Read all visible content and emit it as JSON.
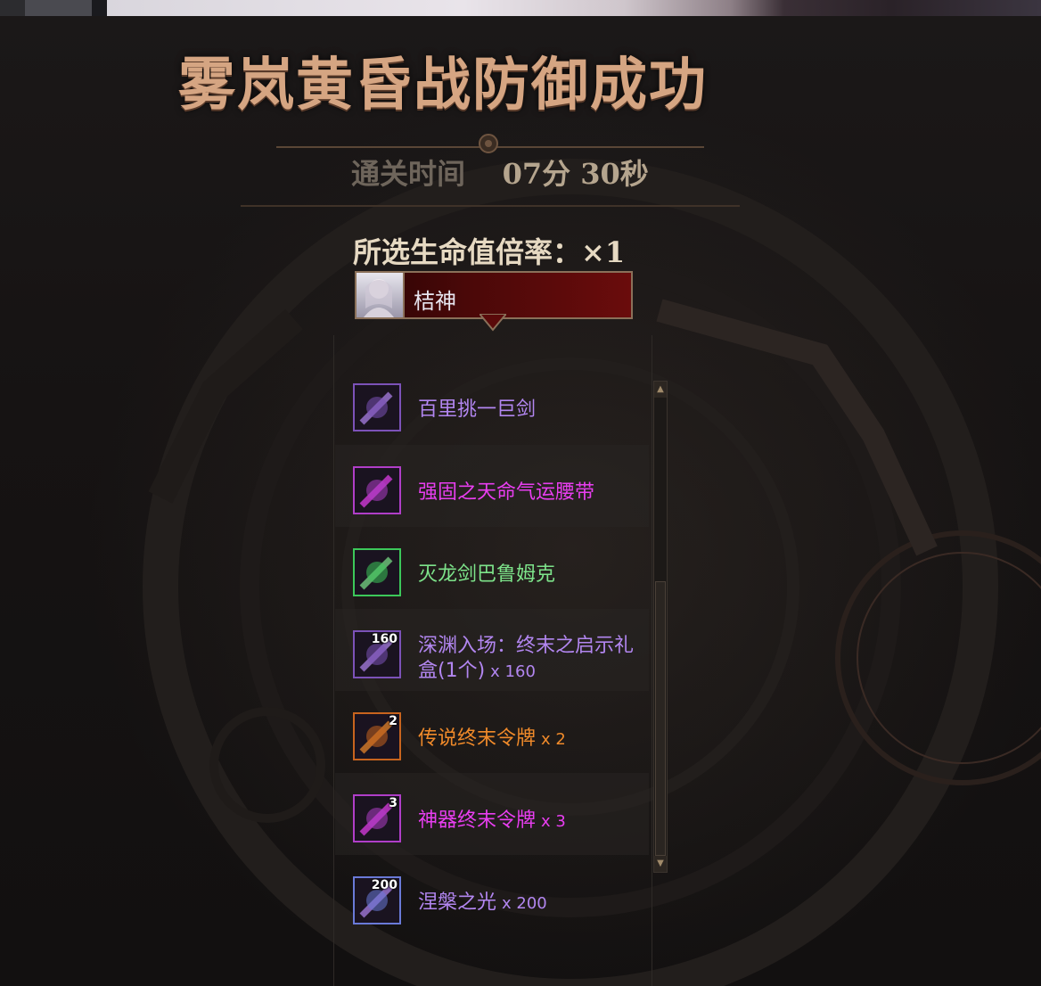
{
  "result": {
    "title": "雾岚黄昏战防御成功",
    "clear_time_label": "通关时间",
    "clear_time_value": "07分 30秒",
    "life_multiplier_label": "所选生命值倍率：×1"
  },
  "character": {
    "name": "桔神"
  },
  "rewards": [
    {
      "name": "百里挑一巨剑",
      "count": "",
      "icon_qty": "",
      "color": "#b286f0",
      "icon": "greatsword-icon",
      "frame": "#7c52b8"
    },
    {
      "name": "强固之天命气运腰带",
      "count": "",
      "icon_qty": "",
      "color": "#e83ef0",
      "icon": "belt-icon",
      "frame": "#b03ec8"
    },
    {
      "name": "灭龙剑巴鲁姆克",
      "count": "",
      "icon_qty": "",
      "color": "#7de38a",
      "icon": "dragon-sword-icon",
      "frame": "#3cc85a"
    },
    {
      "name": "深渊入场：终末之启示礼盒(1个)",
      "count": "x 160",
      "icon_qty": "160",
      "color": "#b286f0",
      "icon": "gift-box-icon",
      "frame": "#7c52b8"
    },
    {
      "name": "传说终末令牌",
      "count": "x 2",
      "icon_qty": "2",
      "color": "#f08a2a",
      "icon": "legendary-token-icon",
      "frame": "#c8641e"
    },
    {
      "name": "神器终末令牌",
      "count": "x 3",
      "icon_qty": "3",
      "color": "#e83ef0",
      "icon": "artifact-token-icon",
      "frame": "#b03ec8"
    },
    {
      "name": "涅槃之光",
      "count": "x 200",
      "icon_qty": "200",
      "color": "#b286f0",
      "icon": "nirvana-light-icon",
      "frame": "#6a7ad8"
    }
  ]
}
